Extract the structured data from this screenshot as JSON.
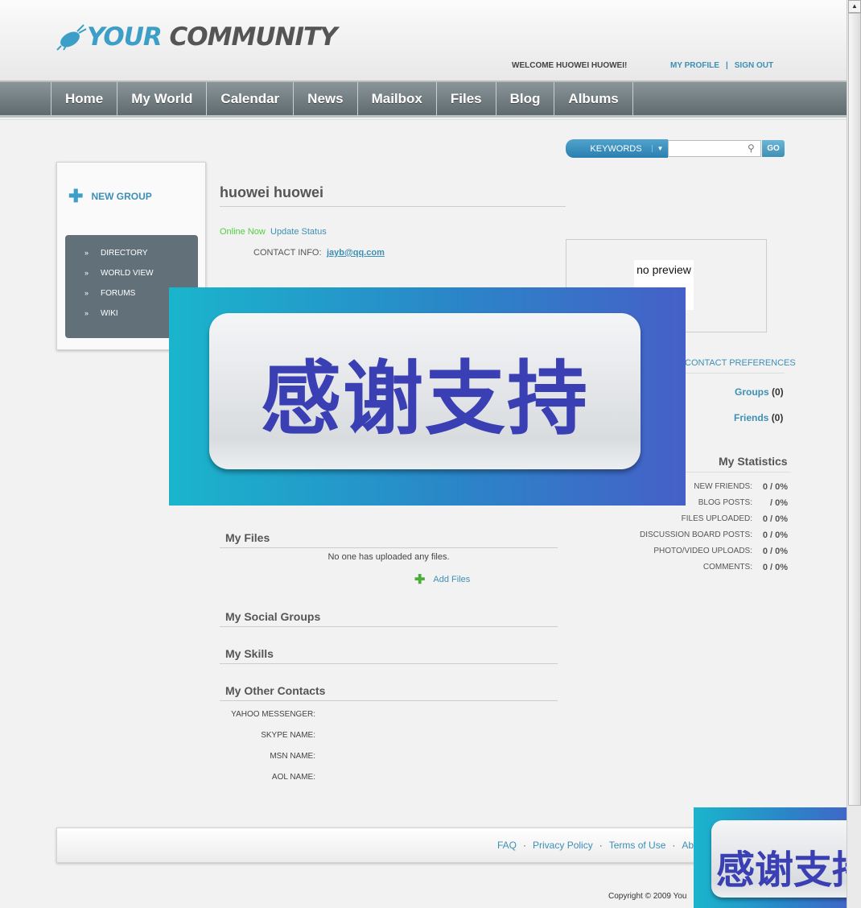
{
  "header": {
    "logo_part1": "YOUR",
    "logo_part2": "COMMUNITY",
    "welcome": "WELCOME HUOWEI HUOWEI!",
    "my_profile": "MY PROFILE",
    "separator": "|",
    "sign_out": "SIGN OUT"
  },
  "nav": {
    "items": [
      "Home",
      "My World",
      "Calendar",
      "News",
      "Mailbox",
      "Files",
      "Blog",
      "Albums"
    ]
  },
  "search": {
    "category": "KEYWORDS",
    "placeholder": "",
    "go": "GO"
  },
  "sidebar": {
    "new_group": "NEW GROUP",
    "items": [
      "DIRECTORY",
      "WORLD VIEW",
      "FORUMS",
      "WIKI"
    ]
  },
  "profile": {
    "name": "huowei huowei",
    "online": "Online Now",
    "update_status": "Update Status",
    "contact_label": "CONTACT INFO:",
    "contact_value": "jayb@qq.com",
    "preview_text": "no preview",
    "contact_prefs": "CONTACT PREFERENCES",
    "groups_label": "Groups",
    "groups_count": "(0)",
    "friends_label": "Friends",
    "friends_count": "(0)"
  },
  "stats": {
    "title": "My  Statistics",
    "rows": [
      {
        "label": "NEW FRIENDS:",
        "value": "0 / 0%"
      },
      {
        "label": "BLOG POSTS:",
        "value": "/ 0%"
      },
      {
        "label": "FILES UPLOADED:",
        "value": "0 / 0%"
      },
      {
        "label": "DISCUSSION BOARD POSTS:",
        "value": "0 / 0%"
      },
      {
        "label": "PHOTO/VIDEO UPLOADS:",
        "value": "0 / 0%"
      },
      {
        "label": "COMMENTS:",
        "value": "0 / 0%"
      }
    ]
  },
  "sections": {
    "files_title": "My Files",
    "files_empty": "No one has uploaded any files.",
    "add_files": "Add Files",
    "social_groups": "My  Social Groups",
    "skills": "My  Skills",
    "other_contacts": "My  Other Contacts",
    "contacts": [
      "YAHOO MESSENGER:",
      "SKYPE NAME:",
      "MSN NAME:",
      "AOL NAME:"
    ]
  },
  "footer": {
    "links": [
      "FAQ",
      "Privacy Policy",
      "Terms of Use",
      "Ab"
    ],
    "dot": "·",
    "copyright": "Copyright © 2009 You"
  },
  "overlay": {
    "text": "感谢支持",
    "text_partial": "感谢支持"
  },
  "colors": {
    "accent": "#3d8fb5",
    "nav_bg": "#6b777b",
    "online": "#4fcf3f",
    "overlay_text": "#3a3fb3"
  }
}
